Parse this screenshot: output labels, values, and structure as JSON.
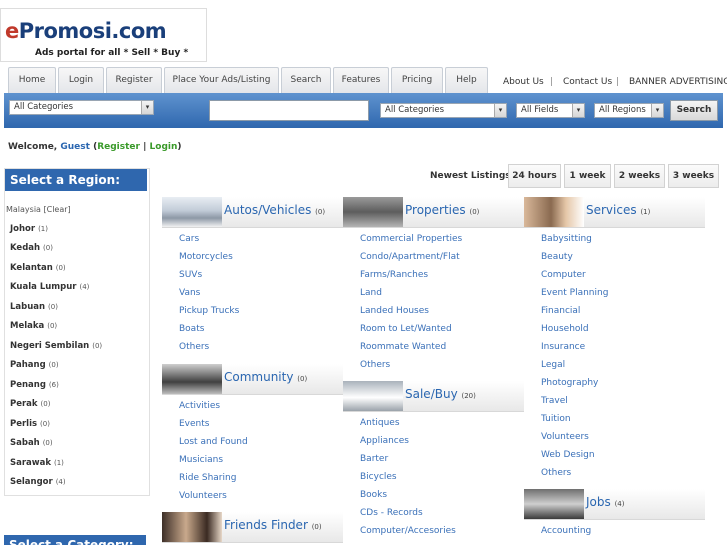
{
  "logo": {
    "title_e": "e",
    "title_rest": "Promosi.com",
    "tagline": "Ads portal for all * Sell * Buy *"
  },
  "nav": {
    "tabs": [
      "Home",
      "Login",
      "Register",
      "Place Your Ads/Listing",
      "Search",
      "Features",
      "Pricing",
      "Help"
    ],
    "links": [
      "About Us",
      "|",
      "Contact Us",
      "|",
      "BANNER ADVERTISING"
    ]
  },
  "search": {
    "category_select_1": "All Categories",
    "category_select_2": "All Categories",
    "fields_select": "All Fields",
    "regions_select": "All Regions",
    "search_button": "Search",
    "arrow": "▾"
  },
  "welcome": {
    "prefix": "Welcome,",
    "user": "Guest",
    "open": "(",
    "register": "Register",
    "sep": "|",
    "login": "Login",
    "close": ")"
  },
  "newest": {
    "label": "Newest Listings:",
    "options": [
      "24 hours",
      "1 week",
      "2 weeks",
      "3 weeks"
    ]
  },
  "sidebar": {
    "title": "Select a Region:",
    "current": "Malaysia [Clear]",
    "regions": [
      {
        "name": "Johor",
        "count": "(1)"
      },
      {
        "name": "Kedah",
        "count": "(0)"
      },
      {
        "name": "Kelantan",
        "count": "(0)"
      },
      {
        "name": "Kuala Lumpur",
        "count": "(4)"
      },
      {
        "name": "Labuan",
        "count": "(0)"
      },
      {
        "name": "Melaka",
        "count": "(0)"
      },
      {
        "name": "Negeri Sembilan",
        "count": "(0)"
      },
      {
        "name": "Pahang",
        "count": "(0)"
      },
      {
        "name": "Penang",
        "count": "(6)"
      },
      {
        "name": "Perak",
        "count": "(0)"
      },
      {
        "name": "Perlis",
        "count": "(0)"
      },
      {
        "name": "Sabah",
        "count": "(0)"
      },
      {
        "name": "Sarawak",
        "count": "(1)"
      },
      {
        "name": "Selangor",
        "count": "(4)"
      }
    ],
    "category_title": "Select a Category:"
  },
  "categories": [
    {
      "title": "Autos/Vehicles",
      "count": "(0)",
      "icon": "car-icon",
      "items": [
        "Cars",
        "Motorcycles",
        "SUVs",
        "Vans",
        "Pickup Trucks",
        "Boats",
        "Others"
      ]
    },
    {
      "title": "Properties",
      "count": "(0)",
      "icon": "house-icon",
      "items": [
        "Commercial Properties",
        "Condo/Apartment/Flat",
        "Farms/Ranches",
        "Land",
        "Landed Houses",
        "Room to Let/Wanted",
        "Roommate Wanted",
        "Others"
      ]
    },
    {
      "title": "Services",
      "count": "(1)",
      "icon": "people-icon",
      "items": [
        "Babysitting",
        "Beauty",
        "Computer",
        "Event Planning",
        "Financial",
        "Household",
        "Insurance",
        "Legal",
        "Photography",
        "Travel",
        "Tuition",
        "Volunteers",
        "Web Design",
        "Others"
      ]
    },
    {
      "title": "Community",
      "count": "(0)",
      "icon": "community-icon",
      "items": [
        "Activities",
        "Events",
        "Lost and Found",
        "Musicians",
        "Ride Sharing",
        "Volunteers"
      ]
    },
    {
      "title": "Sale/Buy",
      "count": "(20)",
      "icon": "sale-icon",
      "items": [
        "Antiques",
        "Appliances",
        "Barter",
        "Bicycles",
        "Books",
        "CDs - Records",
        "Computer/Accesories"
      ]
    },
    {
      "title": "Jobs",
      "count": "(4)",
      "icon": "jobs-icon",
      "items": [
        "Accounting"
      ]
    },
    {
      "title": "Friends Finder",
      "count": "(0)",
      "icon": "friends-icon",
      "items": []
    }
  ],
  "colors": {
    "accent_blue": "#2f67ae",
    "link_blue": "#3a70b8",
    "link_green": "#3a9a2a",
    "logo_red": "#c0392b"
  }
}
